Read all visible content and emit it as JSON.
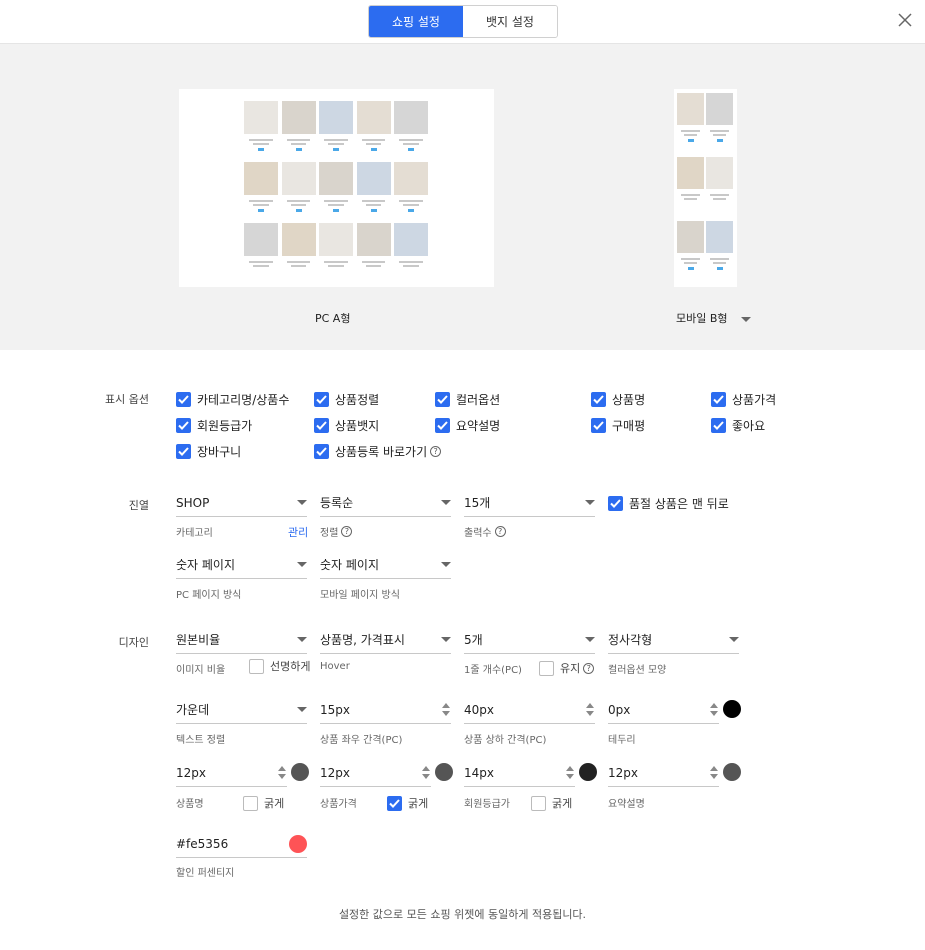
{
  "tabs": {
    "shop": "쇼핑 설정",
    "badge": "뱃지 설정"
  },
  "preview": {
    "pc_label": "PC A형",
    "mobile_label": "모바일 B형"
  },
  "display": {
    "label": "표시 옵션",
    "options": [
      "카테고리명/상품수",
      "상품정렬",
      "컬러옵션",
      "상품명",
      "상품가격",
      "회원등급가",
      "상품뱃지",
      "요약설명",
      "구매평",
      "좋아요",
      "장바구니",
      "상품등록 바로가기"
    ]
  },
  "layout": {
    "label": "진열",
    "category_value": "SHOP",
    "category_sub": "카테고리",
    "manage": "관리",
    "sort_value": "등록순",
    "sort_sub": "정렬",
    "count_value": "15개",
    "count_sub": "출력수",
    "soldout": "품절 상품은 맨 뒤로",
    "pc_paging_value": "숫자 페이지",
    "pc_paging_sub": "PC 페이지 방식",
    "mo_paging_value": "숫자 페이지",
    "mo_paging_sub": "모바일 페이지 방식"
  },
  "design": {
    "label": "디자인",
    "ratio_value": "원본비율",
    "ratio_sub": "이미지 비율",
    "sharp": "선명하게",
    "hover_value": "상품명, 가격표시",
    "hover_sub": "Hover",
    "per_row_value": "5개",
    "per_row_sub": "1줄 개수(PC)",
    "keep": "유지",
    "shape_value": "정사각형",
    "shape_sub": "컬러옵션 모양",
    "align_value": "가운데",
    "align_sub": "텍스트 정렬",
    "hgap_value": "15px",
    "hgap_sub": "상품 좌우 간격(PC)",
    "vgap_value": "40px",
    "vgap_sub": "상품 상하 간격(PC)",
    "border_value": "0px",
    "border_sub": "테두리",
    "name_size": "12px",
    "name_sub": "상품명",
    "price_size": "12px",
    "price_sub": "상품가격",
    "member_size": "14px",
    "member_sub": "회원등급가",
    "summary_size": "12px",
    "summary_sub": "요약설명",
    "bold": "굵게",
    "discount_value": "#fe5356",
    "discount_sub": "할인 퍼센티지"
  },
  "colors": {
    "accent": "#2c6cf0",
    "border_color": "#000000",
    "name_color": "#555555",
    "price_color": "#555555",
    "member_color": "#222222",
    "summary_color": "#555555",
    "discount_color": "#fe5356"
  },
  "footer": "설정한 값으로 모든 쇼핑 위젯에 동일하게 적용됩니다."
}
